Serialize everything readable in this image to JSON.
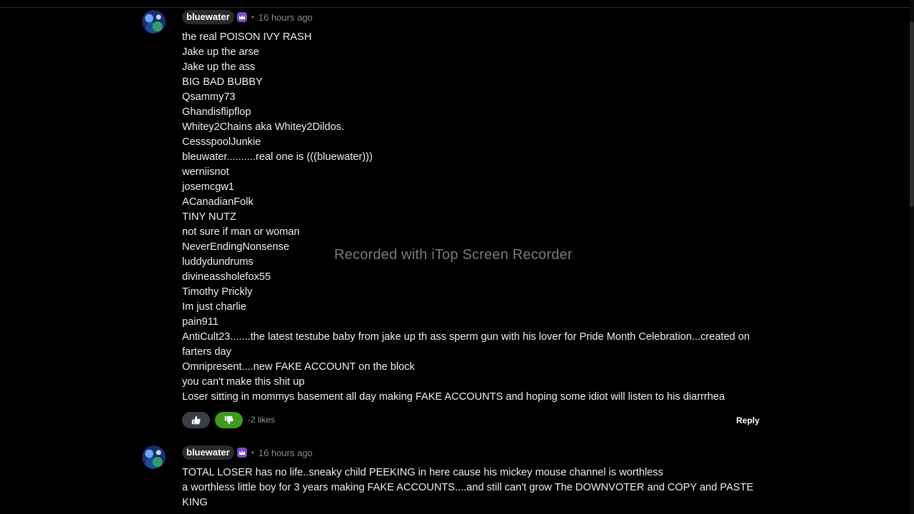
{
  "watermark": "Recorded with iTop Screen Recorder",
  "comments": [
    {
      "username": "bluewater",
      "time": "16 hours ago",
      "lines": [
        "the real POISON IVY RASH",
        "Jake up the arse",
        "Jake up the ass",
        "BIG BAD BUBBY",
        "Qsammy73",
        "Ghandisflipflop",
        "Whitey2Chains aka Whitey2Dildos.",
        "CessspoolJunkie",
        "bleuwater..........real one is (((bluewater)))",
        "werniisnot",
        "josemcgw1",
        "ACanadianFolk",
        "TINY NUTZ",
        "not sure if man or woman",
        "NeverEndingNonsense",
        "luddydundrums",
        "divineassholefox55",
        "Timothy Prickly",
        "Im just charlie",
        "pain911",
        "AntiCult23.......the latest testube baby from jake up th ass sperm gun with his lover for Pride Month Celebration...created on farters day",
        "Omnipresent....new FAKE ACCOUNT on the block",
        "you can't make this shit up",
        "Loser sitting in mommys basement all day making FAKE ACCOUNTS and hoping some idiot will listen to his diarrrhea"
      ],
      "likes": "-2 likes",
      "reply": "Reply"
    },
    {
      "username": "bluewater",
      "time": "16 hours ago",
      "lines": [
        "TOTAL LOSER has no life..sneaky child PEEKING in here cause his mickey mouse channel is worthless",
        "a worthless little boy for 3 years making FAKE ACCOUNTS....and still can't grow The DOWNVOTER and COPY and PASTE KING"
      ]
    }
  ],
  "colors": {
    "background": "#000000",
    "downvote_active": "#3f9a1e",
    "badge": "#7b4cc9"
  },
  "icons": [
    "thumbs-up-icon",
    "thumbs-down-icon",
    "crown-icon"
  ]
}
